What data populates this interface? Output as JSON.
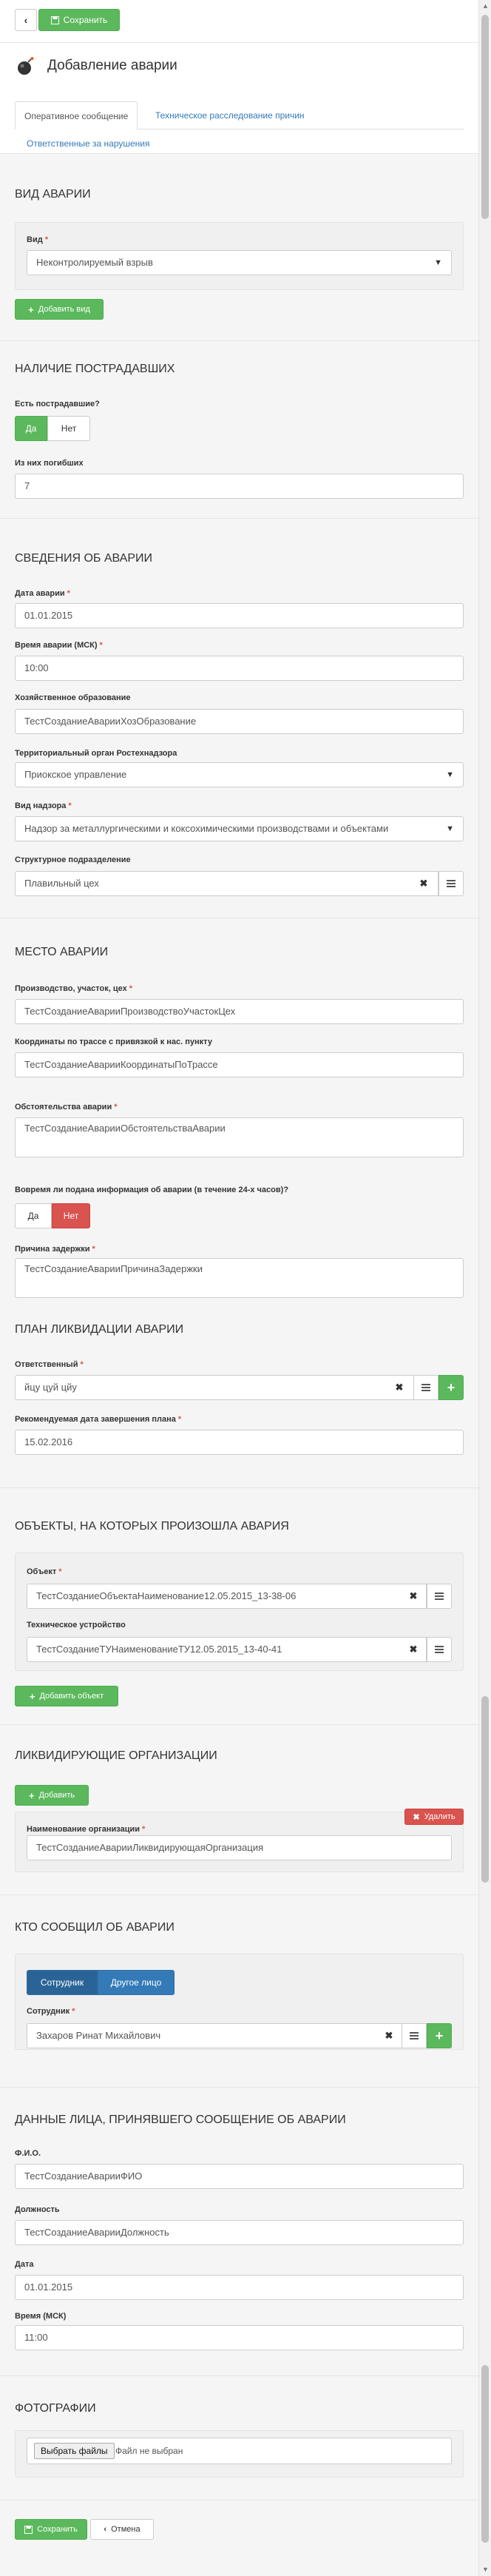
{
  "toolbar": {
    "back_icon": "chevron-left-icon",
    "save_label": "Сохранить",
    "save_icon": "floppy-disk-icon"
  },
  "header": {
    "title": "Добавление аварии",
    "icon": "bomb-icon"
  },
  "tabs": [
    {
      "label": "Оперативное сообщение",
      "active": true
    },
    {
      "label": "Техническое расследование причин",
      "active": false
    },
    {
      "label": "Ответственные за нарушения",
      "active": false
    }
  ],
  "accident_type": {
    "title": "ВИД АВАРИИ",
    "type_label": "Вид",
    "type_value": "Неконтролируемый взрыв",
    "add_button": "Добавить вид"
  },
  "victims": {
    "title": "НАЛИЧИЕ ПОСТРАДАВШИХ",
    "has_victims_label": "Есть пострадавшие?",
    "yes": "Да",
    "no": "Нет",
    "dead_label": "Из них погибших",
    "dead_value": "7"
  },
  "details": {
    "title": "СВЕДЕНИЯ ОБ АВАРИИ",
    "date_label": "Дата аварии",
    "date_value": "01.01.2015",
    "time_label": "Время аварии (МСК)",
    "time_value": "10:00",
    "entity_label": "Хозяйственное образование",
    "entity_value": "ТестСозданиеАварииХозОбразование",
    "authority_label": "Территориальный орган Ростехнадзора",
    "authority_value": "Приокское управление",
    "supervision_label": "Вид надзора",
    "supervision_value": "Надзор за металлургическими и коксохимическими производствами и объектами",
    "unit_label": "Структурное подразделение",
    "unit_value": "Плавильный цех"
  },
  "place": {
    "title": "МЕСТО АВАРИИ",
    "production_label": "Производство, участок, цех",
    "production_value": "ТестСозданиеАварииПроизводствоУчастокЦех",
    "coords_label": "Координаты по трассе с привязкой к нас. пункту",
    "coords_value": "ТестСозданиеАварииКоординатыПоТрассе",
    "circumstances_label": "Обстоятельства аварии",
    "circumstances_value": "ТестСозданиеАварииОбстоятельстваАварии",
    "timely_label": "Вовремя ли подана информация об аварии (в течение 24-х часов)?",
    "yes": "Да",
    "no": "Нет",
    "delay_label": "Причина задержки",
    "delay_value": "ТестСозданиеАварииПричинаЗадержки"
  },
  "plan": {
    "title": "ПЛАН ЛИКВИДАЦИИ АВАРИИ",
    "responsible_label": "Ответственный",
    "responsible_value": "йцу цуй цйу",
    "due_label": "Рекомендуемая дата завершения плана",
    "due_value": "15.02.2016"
  },
  "objects": {
    "title": "ОБЪЕКТЫ, НА КОТОРЫХ ПРОИЗОШЛА АВАРИЯ",
    "object_label": "Объект",
    "object_value": "ТестСозданиеОбъектаНаименование12.05.2015_13-38-06",
    "device_label": "Техническое устройство",
    "device_value": "ТестСозданиеТУНаименованиеТУ12.05.2015_13-40-41",
    "add_button": "Добавить объект"
  },
  "liquidators": {
    "title": "ЛИКВИДИРУЮЩИЕ ОРГАНИЗАЦИИ",
    "add_button": "Добавить",
    "delete_button": "Удалить",
    "org_label": "Наименование организации",
    "org_value": "ТестСозданиеАварииЛиквидирующаяОрганизация"
  },
  "reporter": {
    "title": "КТО СООБЩИЛ ОБ АВАРИИ",
    "employee_tab": "Сотрудник",
    "other_tab": "Другое лицо",
    "employee_label": "Сотрудник",
    "employee_value": "Захаров Ринат Михайлович"
  },
  "receiver": {
    "title": "ДАННЫЕ ЛИЦА, ПРИНЯВШЕГО СООБЩЕНИЕ ОБ АВАРИИ",
    "fio_label": "Ф.И.О.",
    "fio_value": "ТестСозданиеАварииФИО",
    "position_label": "Должность",
    "position_value": "ТестСозданиеАварииДолжность",
    "date_label": "Дата",
    "date_value": "01.01.2015",
    "time_label": "Время (МСК)",
    "time_value": "11:00"
  },
  "photos": {
    "title": "ФОТОГРАФИИ",
    "choose_button": "Выбрать файлы",
    "no_file": "Файл не выбран"
  },
  "footer": {
    "save_label": "Сохранить",
    "cancel_label": "Отмена"
  }
}
